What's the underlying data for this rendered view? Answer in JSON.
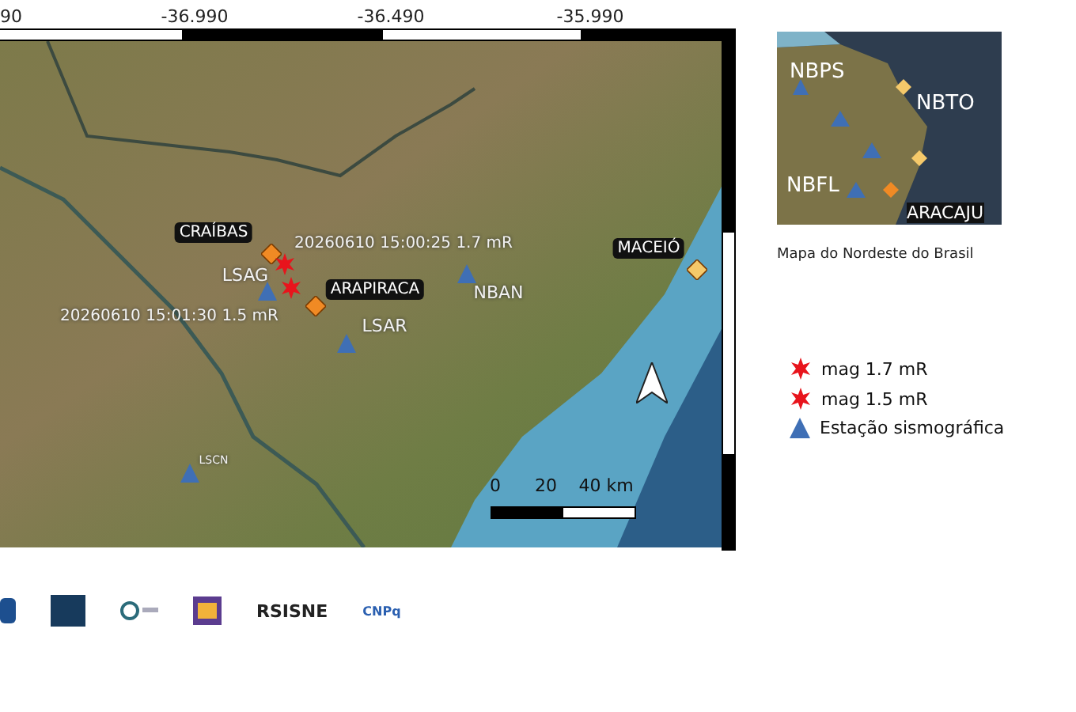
{
  "axis": {
    "ticks": [
      "90",
      "-36.990",
      "-36.490",
      "-35.990"
    ]
  },
  "map": {
    "cities": [
      {
        "name": "CRAÍBAS",
        "color": "#f08a24"
      },
      {
        "name": "ARAPIRACA",
        "color": "#f08a24"
      },
      {
        "name": "MACEIÓ",
        "color": "#f5c96a"
      }
    ],
    "stations": [
      {
        "name": "LSAG"
      },
      {
        "name": "LSAR"
      },
      {
        "name": "NBAN"
      },
      {
        "name": "LSCN"
      }
    ],
    "events": [
      {
        "label": "20260610 15:00:25 1.7 mR"
      },
      {
        "label": "20260610 15:01:30 1.5 mR"
      }
    ],
    "scale": [
      "0",
      "20",
      "40 km"
    ]
  },
  "inset": {
    "labels": [
      "NBPS",
      "NBTO",
      "NBFL",
      "ARACAJU"
    ],
    "caption": "Mapa do Nordeste do Brasil"
  },
  "legend": [
    {
      "kind": "star",
      "label": "mag 1.7 mR"
    },
    {
      "kind": "star",
      "label": "mag 1.5 mR"
    },
    {
      "kind": "triangle",
      "label": "Estação sismográfica"
    }
  ],
  "logos": [
    {
      "kind": "shield"
    },
    {
      "kind": "block"
    },
    {
      "kind": "ring"
    },
    {
      "kind": "badge"
    },
    {
      "kind": "wordmark",
      "text": "RSISNE"
    },
    {
      "kind": "small",
      "text": "CNPq"
    }
  ]
}
